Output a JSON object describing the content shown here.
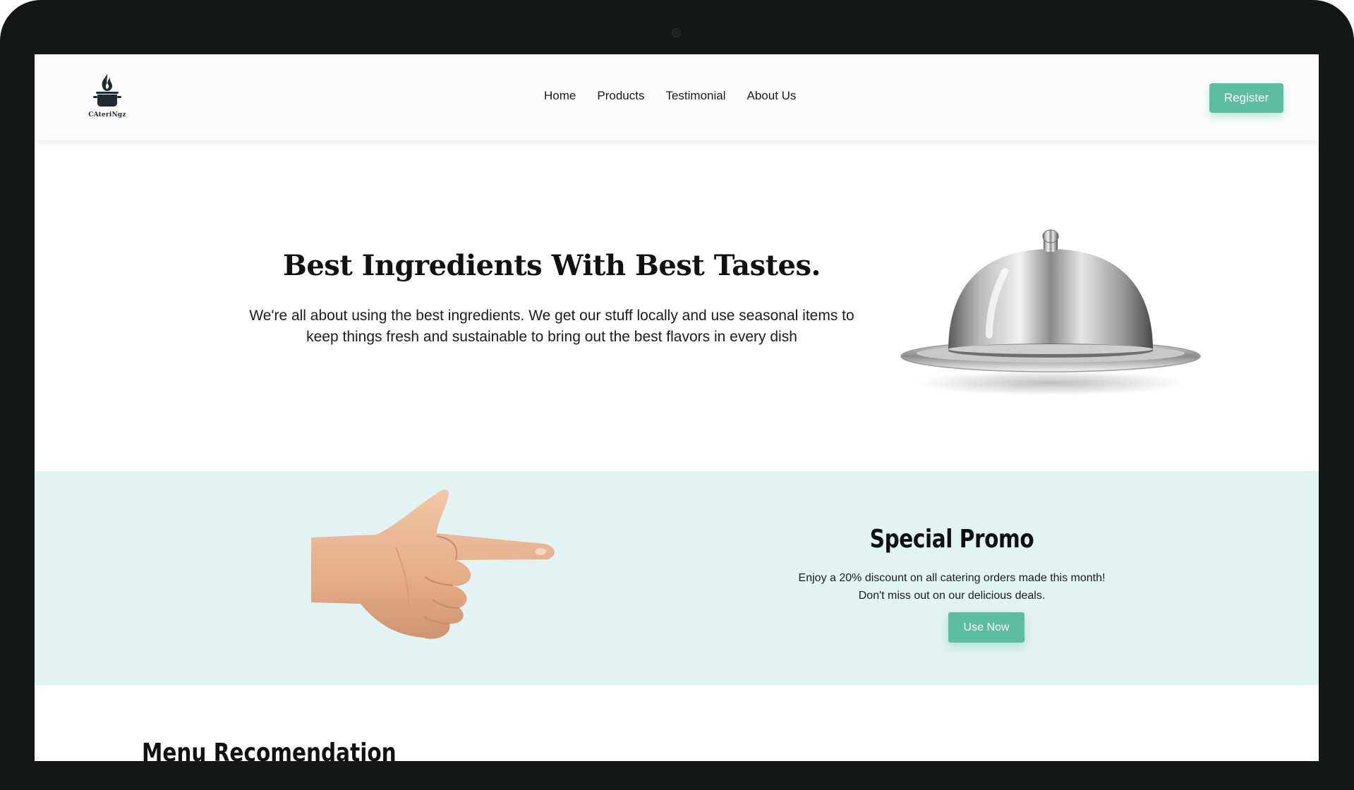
{
  "header": {
    "logo_text": "CAteriNgz",
    "nav": [
      {
        "label": "Home"
      },
      {
        "label": "Products"
      },
      {
        "label": "Testimonial"
      },
      {
        "label": "About Us"
      }
    ],
    "register_label": "Register"
  },
  "hero": {
    "title": "Best Ingredients With Best Tastes.",
    "text": "We're all about using the best ingredients. We get our stuff locally and use seasonal items to keep things fresh and sustainable to bring out the best flavors in every dish",
    "image": "silver-cloche-icon"
  },
  "promo": {
    "title": "Special Promo",
    "text": "Enjoy a 20% discount on all catering orders made this month! Don't miss out on our delicious deals.",
    "button_label": "Use Now",
    "image": "pointing-hand-icon"
  },
  "menu": {
    "title": "Menu Recomendation"
  },
  "colors": {
    "accent": "#5cbda1",
    "promo_bg": "#e2f3f3",
    "bezel": "#131718"
  }
}
